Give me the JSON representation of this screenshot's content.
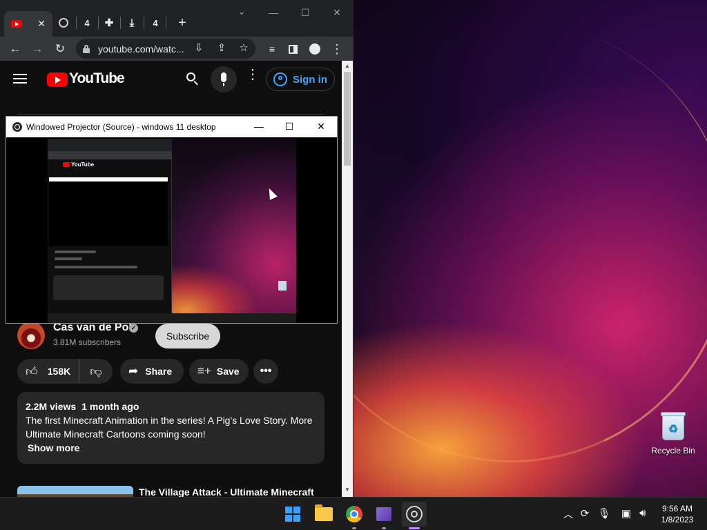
{
  "browser": {
    "tabs": [
      {
        "label": "",
        "icon": "youtube-icon",
        "active": true
      },
      {
        "label": "",
        "icon": "obs-icon"
      },
      {
        "label": "4"
      },
      {
        "label": "",
        "icon": "puzzle-icon"
      },
      {
        "label": "",
        "icon": "download-icon"
      },
      {
        "label": "4"
      }
    ],
    "new_tab_icon": "+",
    "window_controls": {
      "search_tabs": "⌄",
      "minimize": "—",
      "maximize": "☐",
      "close": "✕"
    },
    "url": "youtube.com/watc...",
    "nav": {
      "back": "←",
      "forward": "→",
      "reload": "↻"
    },
    "omnibox_icons": [
      "install-icon",
      "share-icon",
      "star-icon"
    ],
    "toolbar_icons": [
      "media-control-icon",
      "side-panel-icon",
      "profile-icon",
      "menu-icon"
    ]
  },
  "youtube": {
    "logo_text": "YouTube",
    "sign_in": "Sign in",
    "channel": {
      "name": "Cas van de Pol",
      "subscribers": "3.81M subscribers",
      "subscribe": "Subscribe"
    },
    "actions": {
      "likes": "158K",
      "share": "Share",
      "save": "Save",
      "more": "•••"
    },
    "description": {
      "views": "2.2M views",
      "age": "1 month ago",
      "text": "The first Minecraft Animation in the series! A Pig's Love Story. More Ultimate Minecraft Cartoons coming soon!",
      "show_more": "Show more"
    },
    "next_video_title": "The Village Attack - Ultimate Minecraft"
  },
  "projector": {
    "title": "Windowed Projector (Source) - windows 11 desktop",
    "controls": {
      "minimize": "—",
      "maximize": "☐",
      "close": "✕"
    }
  },
  "desktop": {
    "icons": [
      {
        "label": "Recycle Bin",
        "icon": "recycle-bin-icon"
      }
    ]
  },
  "taskbar": {
    "apps": [
      "windows-start-icon",
      "file-explorer-icon",
      "chrome-icon",
      "video-editor-icon",
      "obs-icon"
    ],
    "tray_icons": [
      "chevron-up-icon",
      "sync-icon",
      "microphone-icon",
      "network-icon",
      "volume-icon"
    ],
    "time": "9:56 AM",
    "date": "1/8/2023"
  },
  "colors": {
    "accent": "#3ea6ff",
    "youtube_red": "#ff0000",
    "taskbar_active": "#c28bff"
  }
}
